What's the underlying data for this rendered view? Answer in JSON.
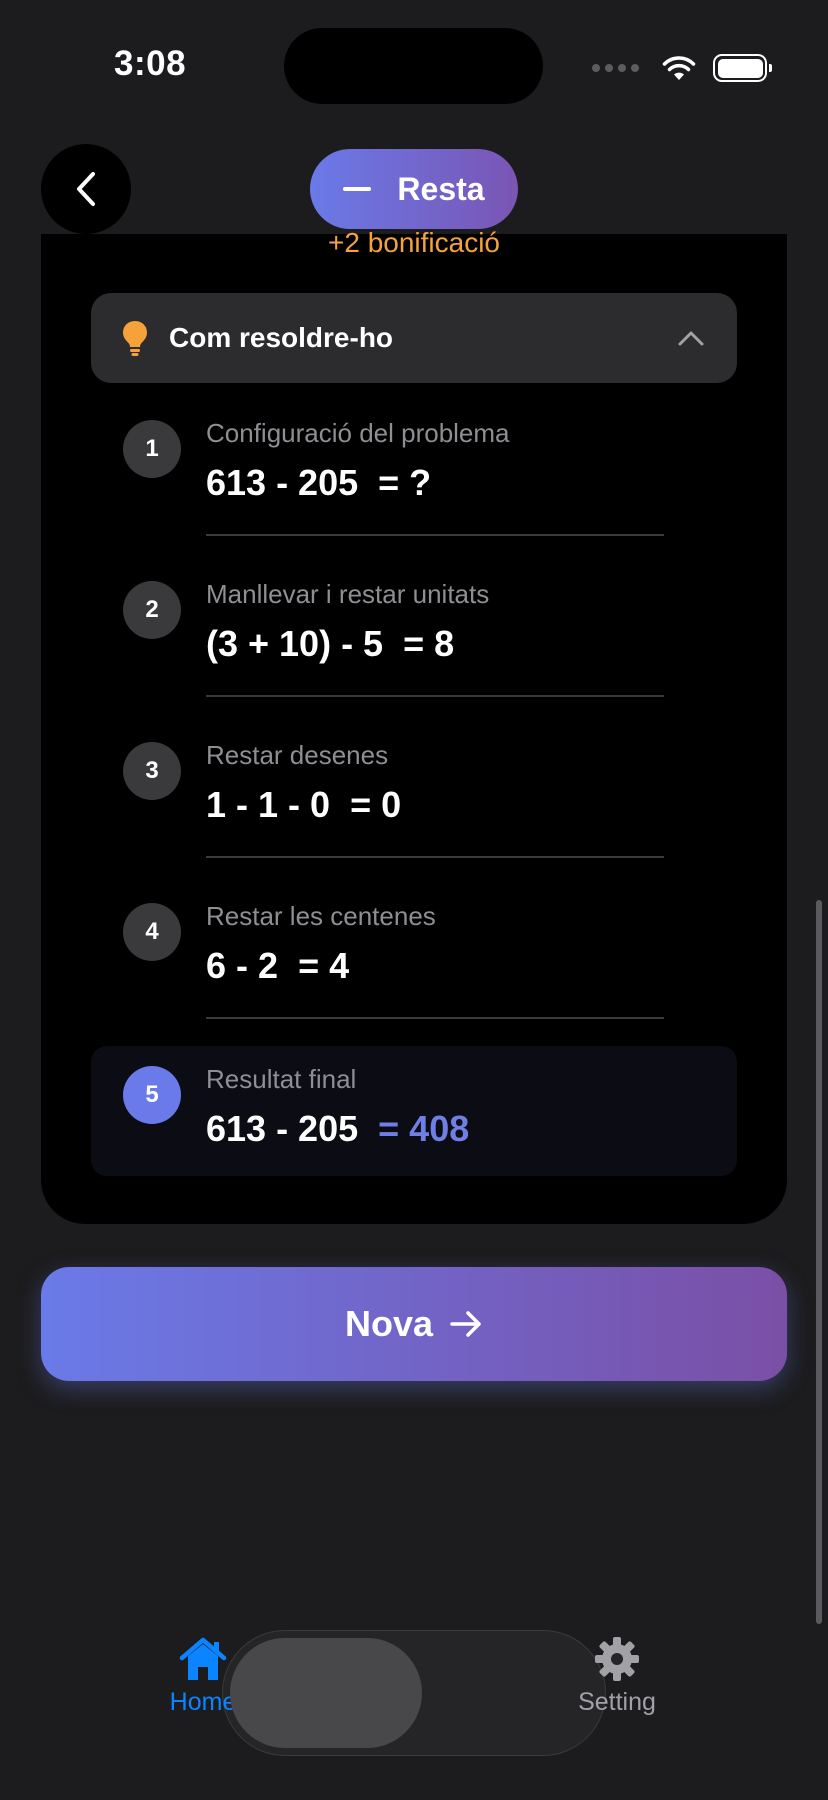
{
  "status_bar": {
    "time": "3:08"
  },
  "header": {
    "back_icon": "chevron-left-icon",
    "mode_icon": "minus-icon",
    "mode_label": "Resta"
  },
  "card": {
    "bonus_text": "+2 bonificació",
    "hint": {
      "icon": "lightbulb-icon",
      "title": "Com resoldre-ho",
      "expanded": true
    },
    "steps": [
      {
        "number": "1",
        "label": "Configuració del problema",
        "expression": "613 - 205 ",
        "result": "= ?"
      },
      {
        "number": "2",
        "label": "Manllevar i restar unitats",
        "expression": "(3 + 10) - 5 ",
        "result": "= 8"
      },
      {
        "number": "3",
        "label": "Restar desenes",
        "expression": "1 - 1 - 0 ",
        "result": "= 0"
      },
      {
        "number": "4",
        "label": "Restar les centenes",
        "expression": "6 - 2 ",
        "result": "= 4"
      }
    ],
    "final_step": {
      "number": "5",
      "label": "Resultat final",
      "expression": "613 - 205 ",
      "result": "= 408",
      "accent_color": "#6f7fe6"
    }
  },
  "action": {
    "next_label": "Nova",
    "next_icon": "arrow-right-icon"
  },
  "tab_bar": {
    "items": [
      {
        "label": "Home",
        "icon": "house-icon",
        "active": true
      },
      {
        "label": "Setting",
        "icon": "gear-icon",
        "active": false
      }
    ]
  },
  "colors": {
    "background": "#1c1c1e",
    "card": "#000000",
    "accent_gradient_start": "#6a7ae8",
    "accent_gradient_end": "#7a4fa6",
    "bonus": "#f6a23a",
    "tab_active": "#0a84ff"
  }
}
